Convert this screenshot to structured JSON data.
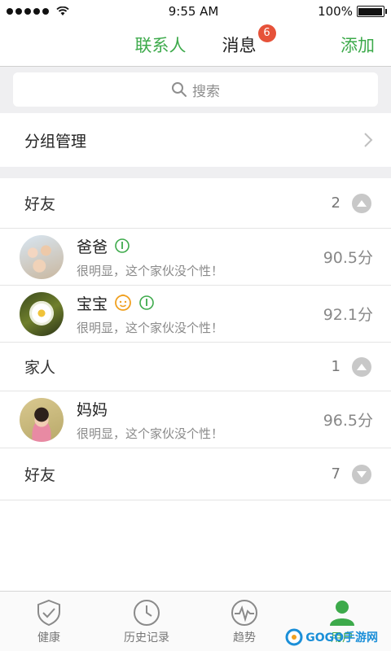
{
  "status_bar": {
    "time": "9:55 AM",
    "battery": "100%"
  },
  "header": {
    "tabs": [
      {
        "label": "联系人"
      },
      {
        "label": "消息",
        "badge": "6"
      }
    ],
    "add_label": "添加"
  },
  "search": {
    "placeholder": "搜索"
  },
  "group_manage": {
    "label": "分组管理"
  },
  "groups": [
    {
      "name": "好友",
      "count": "2",
      "expanded": true,
      "contacts": [
        {
          "name": "爸爸",
          "status": "很明显，这个家伙没个性！",
          "score": "90.5分"
        },
        {
          "name": "宝宝",
          "status": "很明显，这个家伙没个性！",
          "score": "92.1分"
        }
      ]
    },
    {
      "name": "家人",
      "count": "1",
      "expanded": true,
      "contacts": [
        {
          "name": "妈妈",
          "status": "很明显，这个家伙没个性！",
          "score": "96.5分"
        }
      ]
    },
    {
      "name": "好友",
      "count": "7",
      "expanded": false,
      "contacts": []
    }
  ],
  "tabbar": [
    {
      "label": "健康",
      "icon": "shield-check-icon"
    },
    {
      "label": "历史记录",
      "icon": "clock-icon"
    },
    {
      "label": "趋势",
      "icon": "pulse-icon"
    },
    {
      "label": "用户",
      "icon": "user-icon"
    }
  ],
  "watermark": {
    "text": "GOGO手游网"
  },
  "colors": {
    "accent": "#3daa4b",
    "badge": "#e65239",
    "background_gray": "#efeff1"
  }
}
